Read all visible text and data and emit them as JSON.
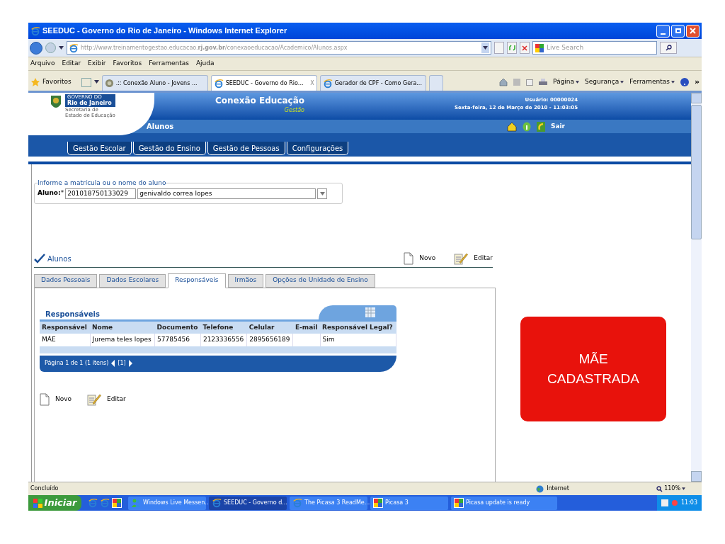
{
  "window": {
    "title": "SEEDUC - Governo do Rio de Janeiro - Windows Internet Explorer"
  },
  "address_bar": {
    "url_pre": "http://www.treinamentogestao.educacao.",
    "url_domain": "rj.gov.br",
    "url_post": "/conexaoeducacao/Academico/Alunos.aspx",
    "search_placeholder": "Live Search"
  },
  "menu": [
    "Arquivo",
    "Editar",
    "Exibir",
    "Favoritos",
    "Ferramentas",
    "Ajuda"
  ],
  "favorites": {
    "label": "Favoritos",
    "tabs": [
      {
        "label": ".:: Conexão Aluno - Jovens ...",
        "selected": false,
        "kind": "seal"
      },
      {
        "label": "SEEDUC - Governo do Rio...",
        "selected": true,
        "kind": "ie"
      },
      {
        "label": "Gerador de CPF - Como Gera...",
        "selected": false,
        "kind": "ie"
      }
    ],
    "close_tab": "X",
    "commands": [
      "Página",
      "Segurança",
      "Ferramentas"
    ],
    "more": "»"
  },
  "header": {
    "logo_small": "GOVERNO DO",
    "logo_name": "Rio de Janeiro",
    "logo_sub1": "Secretaria de",
    "logo_sub2": "Estado de Educação",
    "app_title": "Conexão Educação",
    "app_subtitle": "Gestão",
    "section": "Alunos",
    "user": "Usuário: 00000024",
    "datetime": "Sexta-feira, 12 de Março de 2010 - 11:03:05",
    "logout": "Sair",
    "nav": [
      "Gestão Escolar",
      "Gestão do Ensino",
      "Gestão de Pessoas",
      "Configurações"
    ]
  },
  "search": {
    "legend": "Informe a matrícula ou o nome do aluno",
    "label": "Aluno:",
    "required": "*",
    "id_value": "201018750133029",
    "name_value": "genivaldo correa lopes"
  },
  "section": {
    "title": "Alunos",
    "actions": [
      "Novo",
      "Editar"
    ]
  },
  "tabs": [
    {
      "label": "Dados Pessoais",
      "selected": false
    },
    {
      "label": "Dados Escolares",
      "selected": false
    },
    {
      "label": "Responsáveis",
      "selected": true
    },
    {
      "label": "Irmãos",
      "selected": false
    },
    {
      "label": "Opções de Unidade de Ensino",
      "selected": false
    }
  ],
  "grid": {
    "title": "Responsáveis",
    "columns": [
      "Responsável",
      "Nome",
      "Documento",
      "Telefone",
      "Celular",
      "E-mail",
      "Responsável Legal?"
    ],
    "rows": [
      [
        "MÃE",
        "Jurema teles lopes",
        "57785456",
        "2123336556",
        "2895656189",
        "",
        "Sim"
      ]
    ],
    "pager": "Página 1 de 1 (1 itens)",
    "page": "[1]"
  },
  "bottom_actions": [
    "Novo",
    "Editar"
  ],
  "callout": {
    "lines": [
      "MÃE",
      "CADASTRADA"
    ]
  },
  "status_bar": {
    "text": "Concluído",
    "zone": "Internet",
    "zoom": "110%"
  },
  "taskbar": {
    "start": "Iniciar",
    "items": [
      {
        "label": "Windows Live Messen...",
        "kind": "messenger",
        "selected": false
      },
      {
        "label": "SEEDUC - Governo d...",
        "kind": "ie",
        "selected": true
      },
      {
        "label": "The Picasa 3 ReadMe...",
        "kind": "ie",
        "selected": false
      },
      {
        "label": "Picasa 3",
        "kind": "picasa",
        "selected": false
      },
      {
        "label": "Picasa update is ready",
        "kind": "picasa",
        "selected": false
      }
    ],
    "clock": "11:03"
  }
}
